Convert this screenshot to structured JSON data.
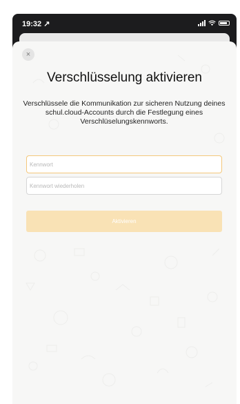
{
  "status_bar": {
    "time": "19:32 ↗"
  },
  "modal": {
    "close_glyph": "×",
    "title": "Verschlüsselung aktivieren",
    "description": "Verschlüssele die Kommunikation zur sicheren Nutzung deines schul.cloud-Accounts durch die Festlegung eines Verschlüselungskennworts.",
    "password_placeholder": "Kennwort",
    "password_repeat_placeholder": "Kennwort wiederholen",
    "submit_label": "Aktivieren"
  },
  "colors": {
    "accent": "#f4c77a",
    "button_disabled": "#f9e2b5",
    "sheet_bg": "#f7f7f6"
  },
  "icons": [
    "close-icon",
    "signal-icon",
    "wifi-icon",
    "battery-icon",
    "location-arrow-icon"
  ]
}
